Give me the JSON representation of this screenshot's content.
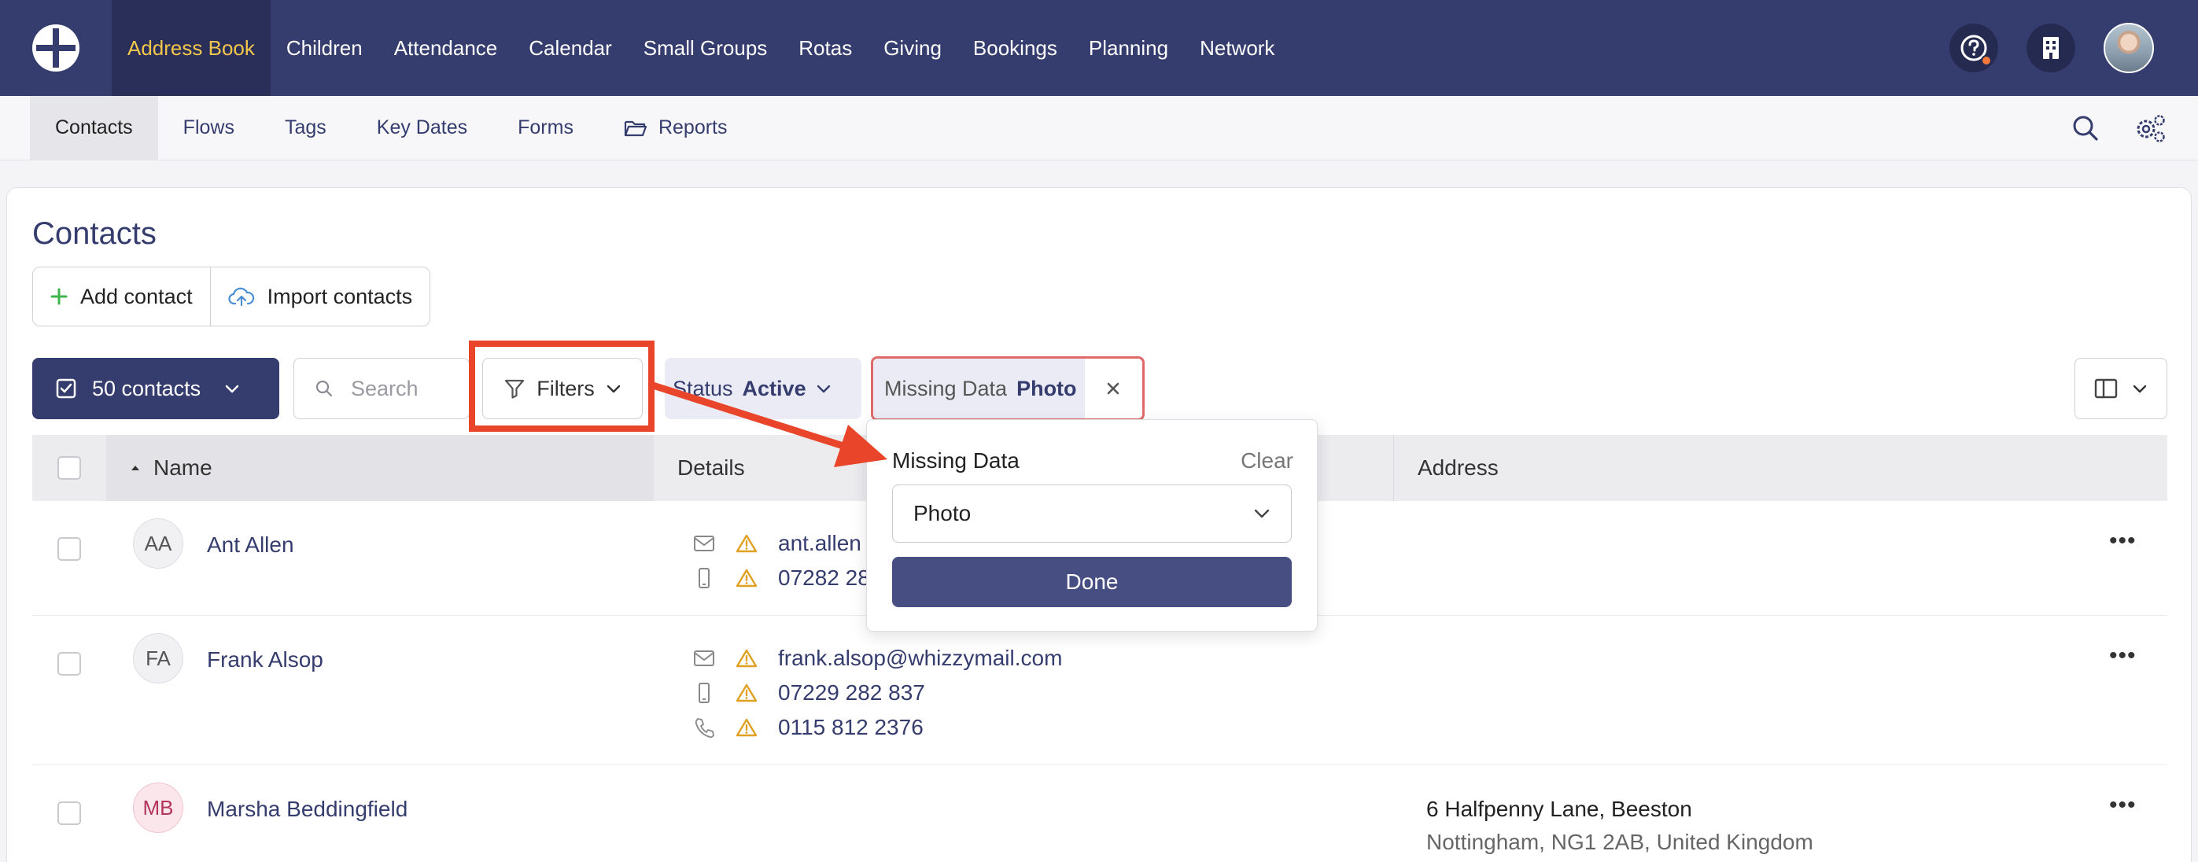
{
  "topnav": {
    "items": [
      "Address Book",
      "Children",
      "Attendance",
      "Calendar",
      "Small Groups",
      "Rotas",
      "Giving",
      "Bookings",
      "Planning",
      "Network"
    ],
    "active_index": 0,
    "notification_color": "#f2793b"
  },
  "subnav": {
    "items": [
      "Contacts",
      "Flows",
      "Tags",
      "Key Dates",
      "Forms",
      "Reports"
    ],
    "active_index": 0
  },
  "page": {
    "title": "Contacts",
    "add_contact": "Add contact",
    "import_contacts": "Import contacts"
  },
  "toolbar": {
    "select_label": "50 contacts",
    "search_placeholder": "Search",
    "filters_label": "Filters",
    "status_label": "Status",
    "status_value": "Active",
    "missing_label": "Missing Data",
    "missing_value": "Photo"
  },
  "table": {
    "headers": {
      "name": "Name",
      "details": "Details",
      "address": "Address"
    },
    "rows": [
      {
        "initials": "AA",
        "name": "Ant Allen",
        "email": "ant.allen",
        "mobile": "07282 28",
        "phone": "",
        "address1": "",
        "address2": ""
      },
      {
        "initials": "FA",
        "name": "Frank Alsop",
        "email": "frank.alsop@whizzymail.com",
        "mobile": "07229 282 837",
        "phone": "0115 812 2376",
        "address1": "",
        "address2": ""
      },
      {
        "initials": "MB",
        "name": "Marsha Beddingfield",
        "email": "",
        "mobile": "",
        "phone": "",
        "address1": "6 Halfpenny Lane, Beeston",
        "address2": "Nottingham, NG1 2AB, United Kingdom"
      }
    ]
  },
  "popover": {
    "label": "Missing Data",
    "clear": "Clear",
    "selected": "Photo",
    "done": "Done"
  },
  "colors": {
    "brand": "#353c6e",
    "active_nav_text": "#f3c64c",
    "highlight": "#e8452b",
    "warning": "#e0a021"
  }
}
